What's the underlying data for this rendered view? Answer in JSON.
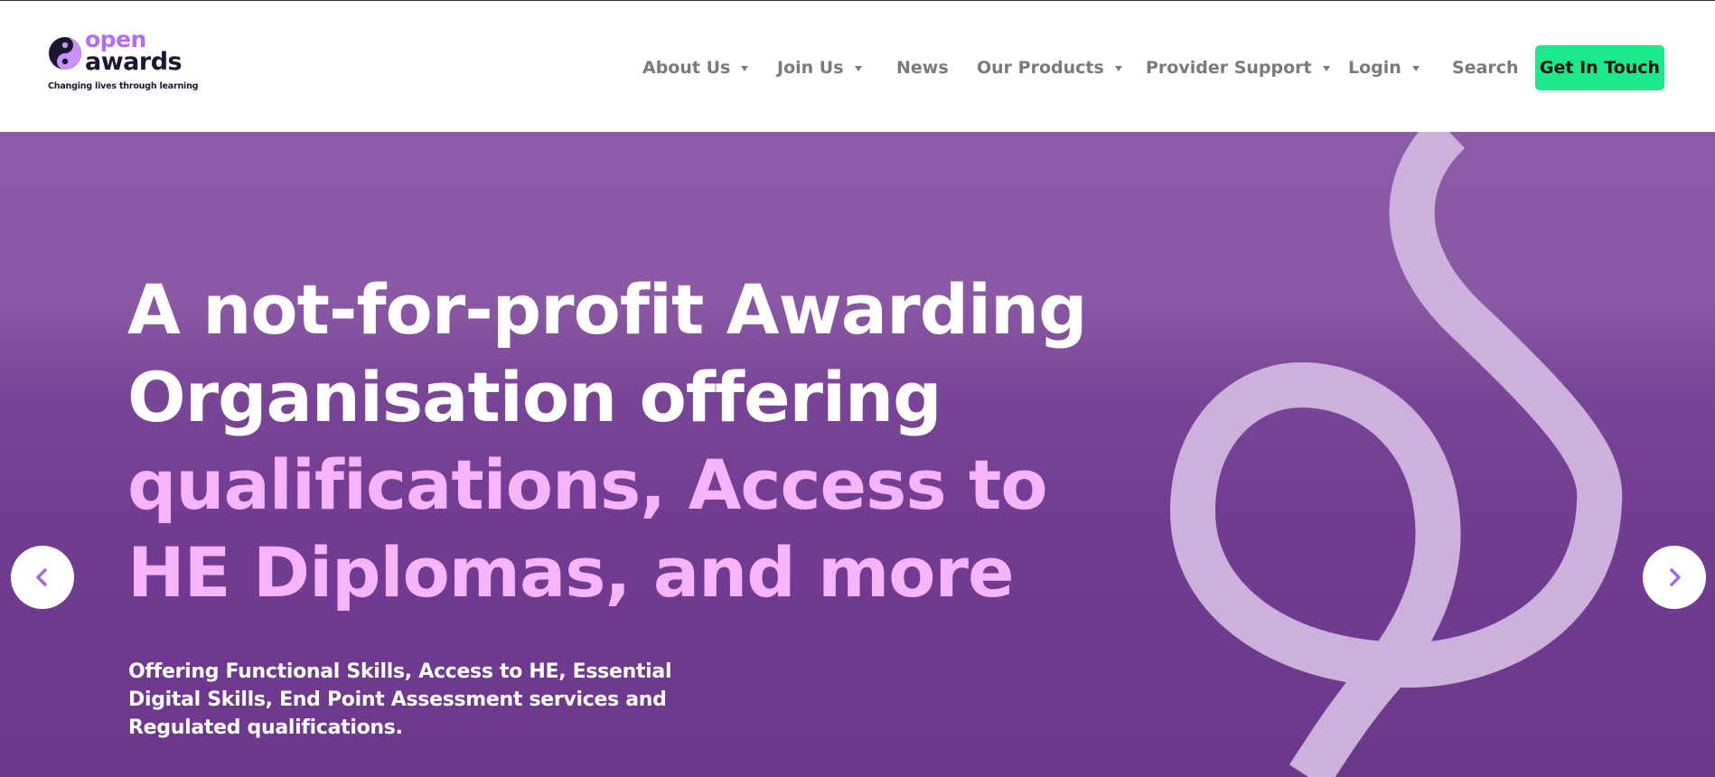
{
  "brand": {
    "logo_open": "open",
    "logo_awards": "awards",
    "tagline": "Changing lives through learning",
    "mark_icon": "open-awards-logo-mark",
    "primary_purple": "#b56cf0",
    "dark_navy": "#1a1730"
  },
  "nav": {
    "items": [
      {
        "label": "About Us",
        "has_dropdown": true
      },
      {
        "label": "Join Us",
        "has_dropdown": true
      },
      {
        "label": "News",
        "has_dropdown": false
      },
      {
        "label": "Our Products",
        "has_dropdown": true
      },
      {
        "label": "Provider Support",
        "has_dropdown": true
      },
      {
        "label": "Login",
        "has_dropdown": true
      },
      {
        "label": "Search",
        "has_dropdown": false
      }
    ],
    "dropdown_icon": "caret-down-icon",
    "cta_label": "Get In Touch",
    "cta_color": "#1de98b"
  },
  "hero": {
    "headline_line1": "A not-for-profit Awarding",
    "headline_line2": "Organisation offering",
    "headline_line3": "qualifications, Access to",
    "headline_line4": "HE Diplomas, and more",
    "headline_white_color": "#ffffff",
    "headline_pink_color": "#f7b4fb",
    "subtext": "Offering Functional Skills, Access to HE, Essential Digital Skills, End Point Assessment services and Regulated qualifications.",
    "background_color": "#7a4597",
    "swirl_color": "#cbb1db",
    "prev_icon": "chevron-left-icon",
    "next_icon": "chevron-right-icon",
    "arrow_color": "#a06be0"
  }
}
